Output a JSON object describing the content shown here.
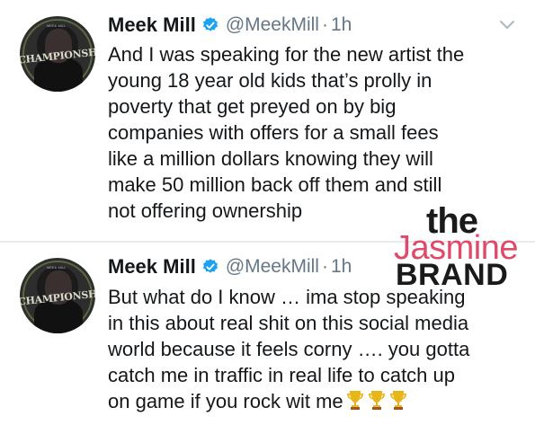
{
  "tweets": [
    {
      "name": "Meek Mill",
      "handle": "@MeekMill",
      "separator": "·",
      "time": "1h",
      "text": "And I was speaking for the new artist the\nyoung 18 year old kids that’s prolly in\npoverty that get preyed on by big\ncompanies with offers for a small fees\nlike a million dollars knowing they will\nmake 50 million back off them and still\nnot offering ownership",
      "avatar_text": "CHAMPIONSHIPS",
      "avatar_top_text": "MEEK MILL"
    },
    {
      "name": "Meek Mill",
      "handle": "@MeekMill",
      "separator": "·",
      "time": "1h",
      "text": "But what do I know … ima stop speaking\nin this about real shit on this social media\nworld because it feels corny …. you gotta\ncatch me in traffic in real life to catch up\non game if you rock wit me",
      "emoji": [
        "trophy-icon",
        "trophy-icon",
        "trophy-icon"
      ],
      "avatar_text": "CHAMPIONSHIPS",
      "avatar_top_text": "MEEK MILL"
    }
  ],
  "watermark": {
    "line1": "the",
    "line2": "Jasmine",
    "line3": "BRAND"
  },
  "colors": {
    "text": "#14171a",
    "secondary": "#657786",
    "verified": "#1da1f2",
    "watermark_accent": "#e04a6a",
    "divider": "#e6ecf0"
  }
}
